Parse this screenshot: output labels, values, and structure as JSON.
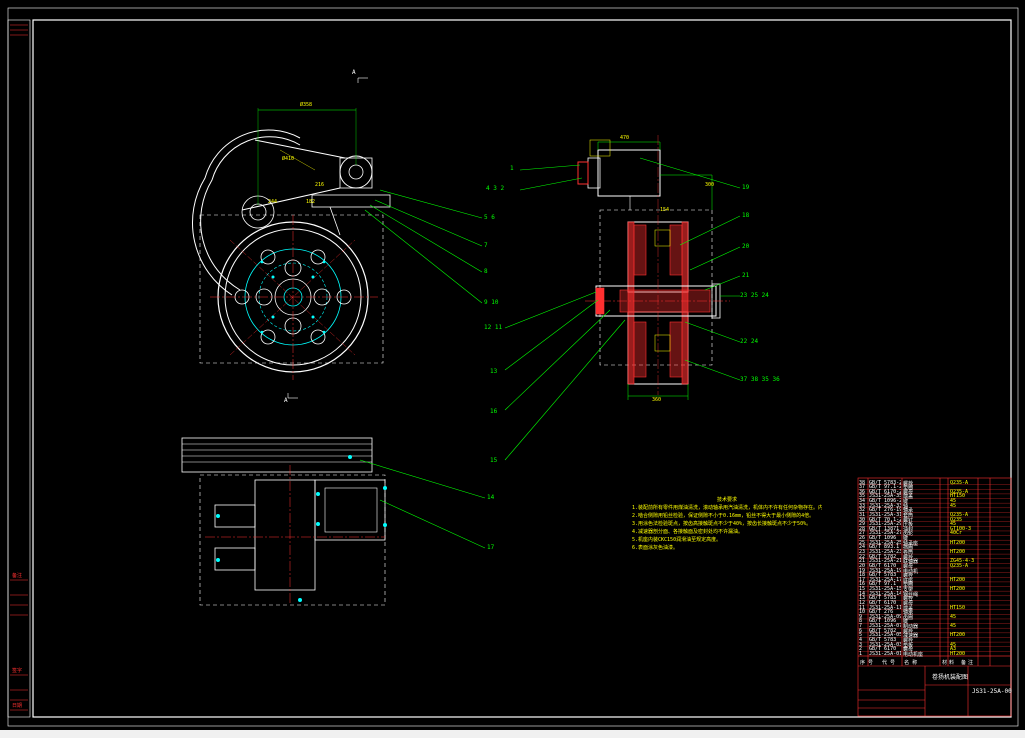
{
  "colors": {
    "background": "#000000",
    "frame": "#ffffff",
    "balloon": "#00ff00",
    "centerline": "#ff3030",
    "dimension": "#ffff00",
    "geometry": "#ffffff",
    "hatch": "#ff3030",
    "cyan": "#00ffff",
    "magenta": "#ff00ff"
  },
  "view_markers": {
    "section_top": "A",
    "section_bottom": "A"
  },
  "balloons": {
    "b1": "1",
    "b2": "4 3 2",
    "b3": "5 6",
    "b4": "7",
    "b5": "8",
    "b6": "9 10",
    "b7": "12 11",
    "b8": "13",
    "b9": "16",
    "b10": "15",
    "b11": "19",
    "b12": "18",
    "b13": "20",
    "b14": "21",
    "b15": "23 25 24",
    "b16": "22 24",
    "b17": "37 38 35 36",
    "b18": "14",
    "b19": "17"
  },
  "dimensions": {
    "d1": "Ø358",
    "d2": "470",
    "d3": "Ø410",
    "d4": "216",
    "d5": "360",
    "d6": "300",
    "d7": "244",
    "d8": "182",
    "d9": "154"
  },
  "notes": {
    "title": "技术要求",
    "lines": [
      "1.装配前所有零件用煤油清洗，滚动轴承用汽油清洗，机体内不许有任何杂物存在。内壁涂上不被机油侵蚀的涂料两次。",
      "2.啮合侧隙用铅丝检验，保证侧隙不小于0.16mm，铅丝不得大于最小侧隙的4倍。",
      "3.用涂色法检验斑点，按齿高接触斑点不少于40%，按齿长接触斑点不少于50%。",
      "4.减速器剖分面、各接触面及密封处均不许漏油。",
      "5.机座内装CKC150润滑油至规定高度。",
      "6.表面涂灰色油漆。"
    ]
  },
  "parts_table": {
    "rows": [
      {
        "no": "38",
        "code": "GB/T 5783-2000",
        "name": "螺栓",
        "mat": "Q235-A"
      },
      {
        "no": "37",
        "code": "GB/T 97.1-2002",
        "name": "垫圈",
        "mat": ""
      },
      {
        "no": "36",
        "code": "GB/T 6170-2000",
        "name": "螺母",
        "mat": "Q235-A"
      },
      {
        "no": "35",
        "code": "JS31-25A-35",
        "name": "端盖",
        "mat": "HT150"
      },
      {
        "no": "34",
        "code": "GB/T 1096-2003",
        "name": "键",
        "mat": "45"
      },
      {
        "no": "33",
        "code": "JS31-25A-33",
        "name": "轴",
        "mat": "45"
      },
      {
        "no": "32",
        "code": "GB/T 276-1994",
        "name": "轴承",
        "mat": ""
      },
      {
        "no": "31",
        "code": "JS31-25A-31",
        "name": "套筒",
        "mat": "Q235-A"
      },
      {
        "no": "30",
        "code": "GB/T 70.1-2000",
        "name": "螺钉",
        "mat": "Q235"
      },
      {
        "no": "29",
        "code": "JS31-25A-29",
        "name": "压板",
        "mat": "45"
      },
      {
        "no": "28",
        "code": "GB/T 13871",
        "name": "油封",
        "mat": "GT100-3"
      },
      {
        "no": "27",
        "code": "JS31-25A-27",
        "name": "齿轮",
        "mat": "40Cr"
      },
      {
        "no": "26",
        "code": "GB/T 1096",
        "name": "键",
        "mat": ""
      },
      {
        "no": "25",
        "code": "JS31-25A-25",
        "name": "轴承座",
        "mat": "HT200"
      },
      {
        "no": "24",
        "code": "GB/T 893.1",
        "name": "挡圈",
        "mat": ""
      },
      {
        "no": "23",
        "code": "JS31-25A-23",
        "name": "卷筒",
        "mat": "HT200"
      },
      {
        "no": "22",
        "code": "GB/T 5782",
        "name": "螺栓",
        "mat": ""
      },
      {
        "no": "21",
        "code": "JS31-25A-21",
        "name": "联轴器",
        "mat": "ZG45-4-3"
      },
      {
        "no": "20",
        "code": "GB/T 6170",
        "name": "螺母",
        "mat": "Q235-A"
      },
      {
        "no": "19",
        "code": "JS31-25A-19",
        "name": "电动机",
        "mat": ""
      },
      {
        "no": "18",
        "code": "GB/T 5783",
        "name": "螺栓",
        "mat": ""
      },
      {
        "no": "17",
        "code": "JS31-25A-17",
        "name": "底座",
        "mat": "HT200"
      },
      {
        "no": "16",
        "code": "GB/T 97.1",
        "name": "垫圈",
        "mat": ""
      },
      {
        "no": "15",
        "code": "JS31-25A-15",
        "name": "支架",
        "mat": "HT200"
      },
      {
        "no": "14",
        "code": "JS31-25A-14",
        "name": "钢丝绳",
        "mat": ""
      },
      {
        "no": "13",
        "code": "GB/T 5783",
        "name": "螺栓",
        "mat": ""
      },
      {
        "no": "12",
        "code": "GB/T 6170",
        "name": "螺母",
        "mat": ""
      },
      {
        "no": "11",
        "code": "JS31-25A-11",
        "name": "端盖",
        "mat": "HT150"
      },
      {
        "no": "10",
        "code": "GB/T 276",
        "name": "轴承",
        "mat": ""
      },
      {
        "no": "9",
        "code": "JS31-25A-09",
        "name": "齿圈",
        "mat": "45"
      },
      {
        "no": "8",
        "code": "GB/T 1096",
        "name": "键",
        "mat": ""
      },
      {
        "no": "7",
        "code": "JS31-25A-07",
        "name": "制动器",
        "mat": "45"
      },
      {
        "no": "6",
        "code": "GB/T 5782",
        "name": "螺栓",
        "mat": ""
      },
      {
        "no": "5",
        "code": "JS31-25A-05",
        "name": "减速器",
        "mat": "HT200"
      },
      {
        "no": "4",
        "code": "GB/T 5783",
        "name": "螺栓",
        "mat": ""
      },
      {
        "no": "3",
        "code": "JS31-25A-03",
        "name": "垫板",
        "mat": "45"
      },
      {
        "no": "2",
        "code": "GB/T 6170",
        "name": "螺母",
        "mat": "A3"
      },
      {
        "no": "1",
        "code": "JS31-25A-01",
        "name": "电动机座",
        "mat": "HT200"
      }
    ],
    "header": {
      "no": "序号",
      "code": "代号",
      "name": "名称",
      "qty": "数量",
      "mat": "材料",
      "remark": "备注"
    },
    "title_label": "卷扬机装配图",
    "drawing_no": "JS31-25A-00"
  },
  "side_strip": {
    "top": "备注",
    "mid": "签字",
    "bottom": "日期"
  }
}
